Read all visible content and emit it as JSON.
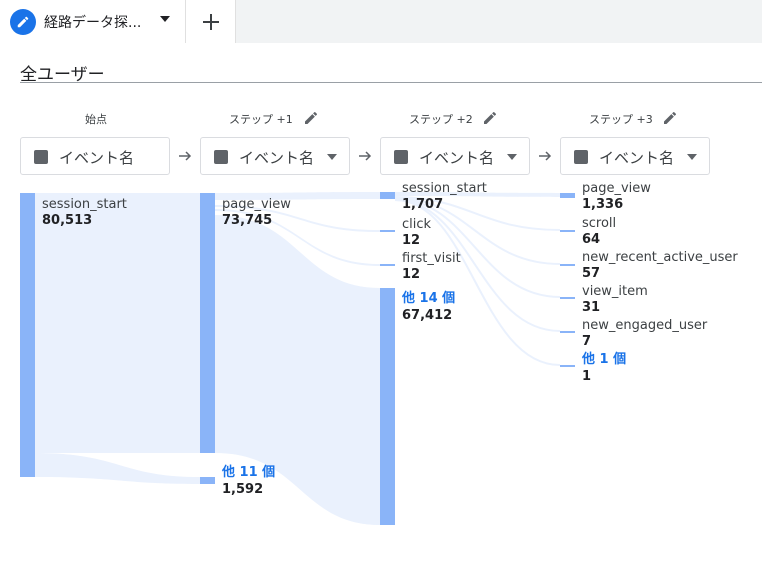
{
  "tab": {
    "title": "経路データ探...",
    "add_label": "+"
  },
  "segment": {
    "title": "全ユーザー"
  },
  "columns": [
    {
      "label": "始点",
      "dropdown": "イベント名"
    },
    {
      "label": "ステップ +1",
      "dropdown": "イベント名"
    },
    {
      "label": "ステップ +2",
      "dropdown": "イベント名"
    },
    {
      "label": "ステップ +3",
      "dropdown": "イベント名"
    }
  ],
  "nodes": {
    "start": [
      {
        "name": "session_start",
        "value": "80,513"
      }
    ],
    "step1": [
      {
        "name": "page_view",
        "value": "73,745"
      },
      {
        "name": "他 11 個",
        "value": "1,592"
      }
    ],
    "step2": [
      {
        "name": "session_start",
        "value": "1,707"
      },
      {
        "name": "click",
        "value": "12"
      },
      {
        "name": "first_visit",
        "value": "12"
      },
      {
        "name": "他 14 個",
        "value": "67,412"
      }
    ],
    "step3": [
      {
        "name": "page_view",
        "value": "1,336"
      },
      {
        "name": "scroll",
        "value": "64"
      },
      {
        "name": "new_recent_active_user",
        "value": "57"
      },
      {
        "name": "view_item",
        "value": "31"
      },
      {
        "name": "new_engaged_user",
        "value": "7"
      },
      {
        "name": "他 1 個",
        "value": "1"
      }
    ]
  },
  "colors": {
    "bar": "#8ab4f8",
    "flow": "#e8f0fe",
    "accent": "#1a73e8"
  }
}
